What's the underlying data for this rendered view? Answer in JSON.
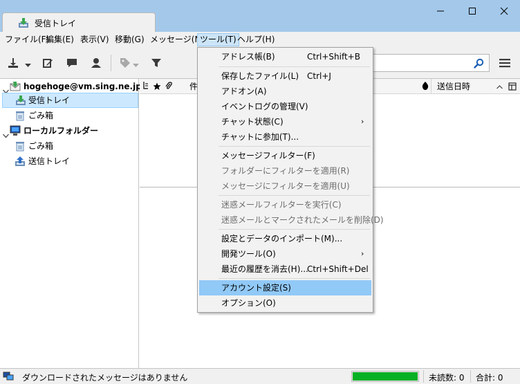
{
  "window": {
    "tab_title": "受信トレイ"
  },
  "menubar": {
    "items": [
      {
        "label": "ファイル(F)"
      },
      {
        "label": "編集(E)"
      },
      {
        "label": "表示(V)"
      },
      {
        "label": "移動(G)"
      },
      {
        "label": "メッセージ(M)"
      },
      {
        "label": "ツール(T)"
      },
      {
        "label": "ヘルプ(H)"
      }
    ]
  },
  "folders": {
    "account": "hogehoge@vm.sing.ne.jp",
    "inbox": "受信トレイ",
    "trash": "ごみ箱",
    "local": "ローカルフォルダー",
    "local_trash": "ごみ箱",
    "outbox": "送信トレイ"
  },
  "thread_header": {
    "subject_partial": "件",
    "date": "送信日時"
  },
  "tools_menu": {
    "address_book": {
      "label": "アドレス帳(B)",
      "shortcut": "Ctrl+Shift+B"
    },
    "saved_files": {
      "label": "保存したファイル(L)",
      "shortcut": "Ctrl+J"
    },
    "addons": {
      "label": "アドオン(A)"
    },
    "event_log": {
      "label": "イベントログの管理(V)"
    },
    "chat_status": {
      "label": "チャット状態(C)",
      "arrow": "›"
    },
    "join_chat": {
      "label": "チャットに参加(T)..."
    },
    "message_filters": {
      "label": "メッセージフィルター(F)"
    },
    "apply_filters_folder": {
      "label": "フォルダーにフィルターを適用(R)"
    },
    "apply_filters_message": {
      "label": "メッセージにフィルターを適用(U)"
    },
    "run_junk_filter": {
      "label": "迷惑メールフィルターを実行(C)"
    },
    "delete_junk": {
      "label": "迷惑メールとマークされたメールを削除(D)"
    },
    "import": {
      "label": "設定とデータのインポート(M)..."
    },
    "dev_tools": {
      "label": "開発ツール(O)",
      "arrow": "›"
    },
    "clear_history": {
      "label": "最近の履歴を消去(H)...",
      "shortcut": "Ctrl+Shift+Del"
    },
    "account_settings": {
      "label": "アカウント設定(S)"
    },
    "options": {
      "label": "オプション(O)"
    }
  },
  "statusbar": {
    "message": "ダウンロードされたメッセージはありません",
    "progress": 1.0,
    "unread": "未読数: 0",
    "total": "合計: 0"
  },
  "colors": {
    "titlebar": "#a3c8ea",
    "highlight": "#91c9f7",
    "selected_folder": "#cce8ff",
    "progress": "#06b025"
  }
}
